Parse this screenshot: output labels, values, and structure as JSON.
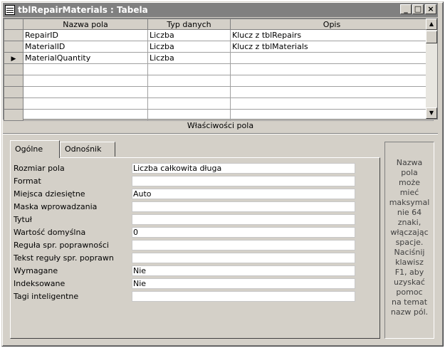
{
  "window": {
    "title": "tblRepairMaterials : Tabela",
    "minimize": "_",
    "maximize": "□",
    "close": "×"
  },
  "grid": {
    "columns": [
      "Nazwa pola",
      "Typ danych",
      "Opis"
    ],
    "rows": [
      {
        "name": "RepairID",
        "type": "Liczba",
        "desc": "Klucz z tblRepairs",
        "current": false
      },
      {
        "name": "MaterialID",
        "type": "Liczba",
        "desc": "Klucz z tblMaterials",
        "current": false
      },
      {
        "name": "MaterialQuantity",
        "type": "Liczba",
        "desc": "",
        "current": true
      },
      {
        "name": "",
        "type": "",
        "desc": "",
        "current": false
      },
      {
        "name": "",
        "type": "",
        "desc": "",
        "current": false
      },
      {
        "name": "",
        "type": "",
        "desc": "",
        "current": false
      },
      {
        "name": "",
        "type": "",
        "desc": "",
        "current": false
      },
      {
        "name": "",
        "type": "",
        "desc": "",
        "current": false
      }
    ],
    "current_row_marker": "▶"
  },
  "properties": {
    "title": "Właściwości pola",
    "tabs": [
      "Ogólne",
      "Odnośnik"
    ],
    "active_tab": "Ogólne",
    "fields": [
      {
        "label": "Rozmiar pola",
        "value": "Liczba całkowita długa"
      },
      {
        "label": "Format",
        "value": ""
      },
      {
        "label": "Miejsca dziesiętne",
        "value": "Auto"
      },
      {
        "label": "Maska wprowadzania",
        "value": ""
      },
      {
        "label": "Tytuł",
        "value": ""
      },
      {
        "label": "Wartość domyślna",
        "value": "0"
      },
      {
        "label": "Reguła spr. poprawności",
        "value": ""
      },
      {
        "label": "Tekst reguły spr. poprawn",
        "value": ""
      },
      {
        "label": "Wymagane",
        "value": "Nie"
      },
      {
        "label": "Indeksowane",
        "value": "Nie"
      },
      {
        "label": "Tagi inteligentne",
        "value": ""
      }
    ],
    "help_lines": [
      "Nazwa",
      "pola",
      "może",
      "mieć",
      "maksymal",
      "nie 64",
      "znaki,",
      "włączając",
      "spacje.",
      "Naciśnij",
      "klawisz",
      "F1, aby",
      "uzyskać",
      "pomoc",
      "na temat",
      "nazw pól."
    ]
  }
}
